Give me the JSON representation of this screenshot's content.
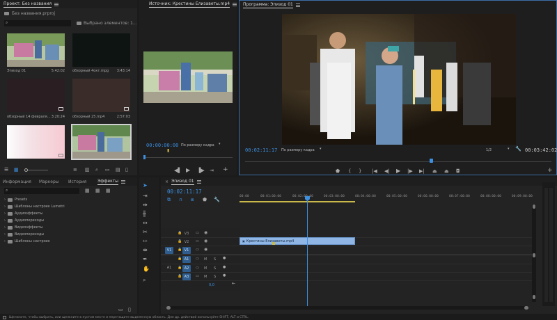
{
  "project": {
    "title": "Проект: Без названия",
    "file": "Без названия.prproj",
    "selected": "Выбрано элементов: 1...",
    "items": [
      {
        "name": "Эпизод 01",
        "duration": "5:42:02"
      },
      {
        "name": "обзорный 4окт.mpg",
        "duration": "3:43:14"
      },
      {
        "name": "обзорный 14 февраля...",
        "duration": "3:20:24"
      },
      {
        "name": "обзорный 25.mp4",
        "duration": "2:57:03"
      },
      {
        "name": "",
        "duration": ""
      },
      {
        "name": "",
        "duration": ""
      }
    ]
  },
  "source": {
    "title": "Источник: Крестины Елизаветы.mp4",
    "timecode": "00:00:00:00",
    "fit": "По размеру кадра"
  },
  "program": {
    "title": "Программа: Эпизод 01",
    "timecode": "00:02:11:17",
    "fit": "По размеру кадра",
    "quality": "1/2",
    "duration": "00:03:42:02"
  },
  "effects": {
    "tabs": [
      "Информация",
      "Маркеры",
      "История",
      "Эффекты"
    ],
    "active_tab": "Эффекты",
    "folders": [
      "Presets",
      "Шаблоны настроек Lumetri",
      "Аудиоэффекты",
      "Аудиопереходы",
      "Видеоэффекты",
      "Видеопереходы",
      "Шаблоны настроек"
    ]
  },
  "timeline": {
    "title": "Эпизод 01",
    "timecode": "00:02:11:17",
    "ruler": [
      "00:00",
      "00:01:00:00",
      "00:02:00:00",
      "00:03:00:00",
      "00:04:00:00",
      "00:05:00:00",
      "00:06:00:00",
      "00:07:00:00",
      "00:08:00:00",
      "00:09:00:00"
    ],
    "video_tracks": [
      "V3",
      "V2",
      "V1"
    ],
    "audio_tracks": [
      "A1",
      "A2",
      "A3"
    ],
    "src_v": "V1",
    "src_a": "A1",
    "clip": "Крестины Елизаветы.mp4",
    "volume": "0,0"
  },
  "status": "Щелкните, чтобы выбрать, или щелкните в пустом месте и перетащите выделенную область. Для др. действий используйте SHIFT, ALT и CTRL.",
  "icons": [
    "search-icon",
    "folder-icon",
    "menu-icon",
    "play-icon",
    "step-back-icon",
    "step-forward-icon",
    "marker-icon",
    "wrench-icon",
    "camera-icon",
    "add-icon",
    "selection-tool-icon",
    "hand-tool-icon",
    "zoom-tool-icon",
    "pen-tool-icon",
    "eye-icon",
    "lock-icon"
  ]
}
